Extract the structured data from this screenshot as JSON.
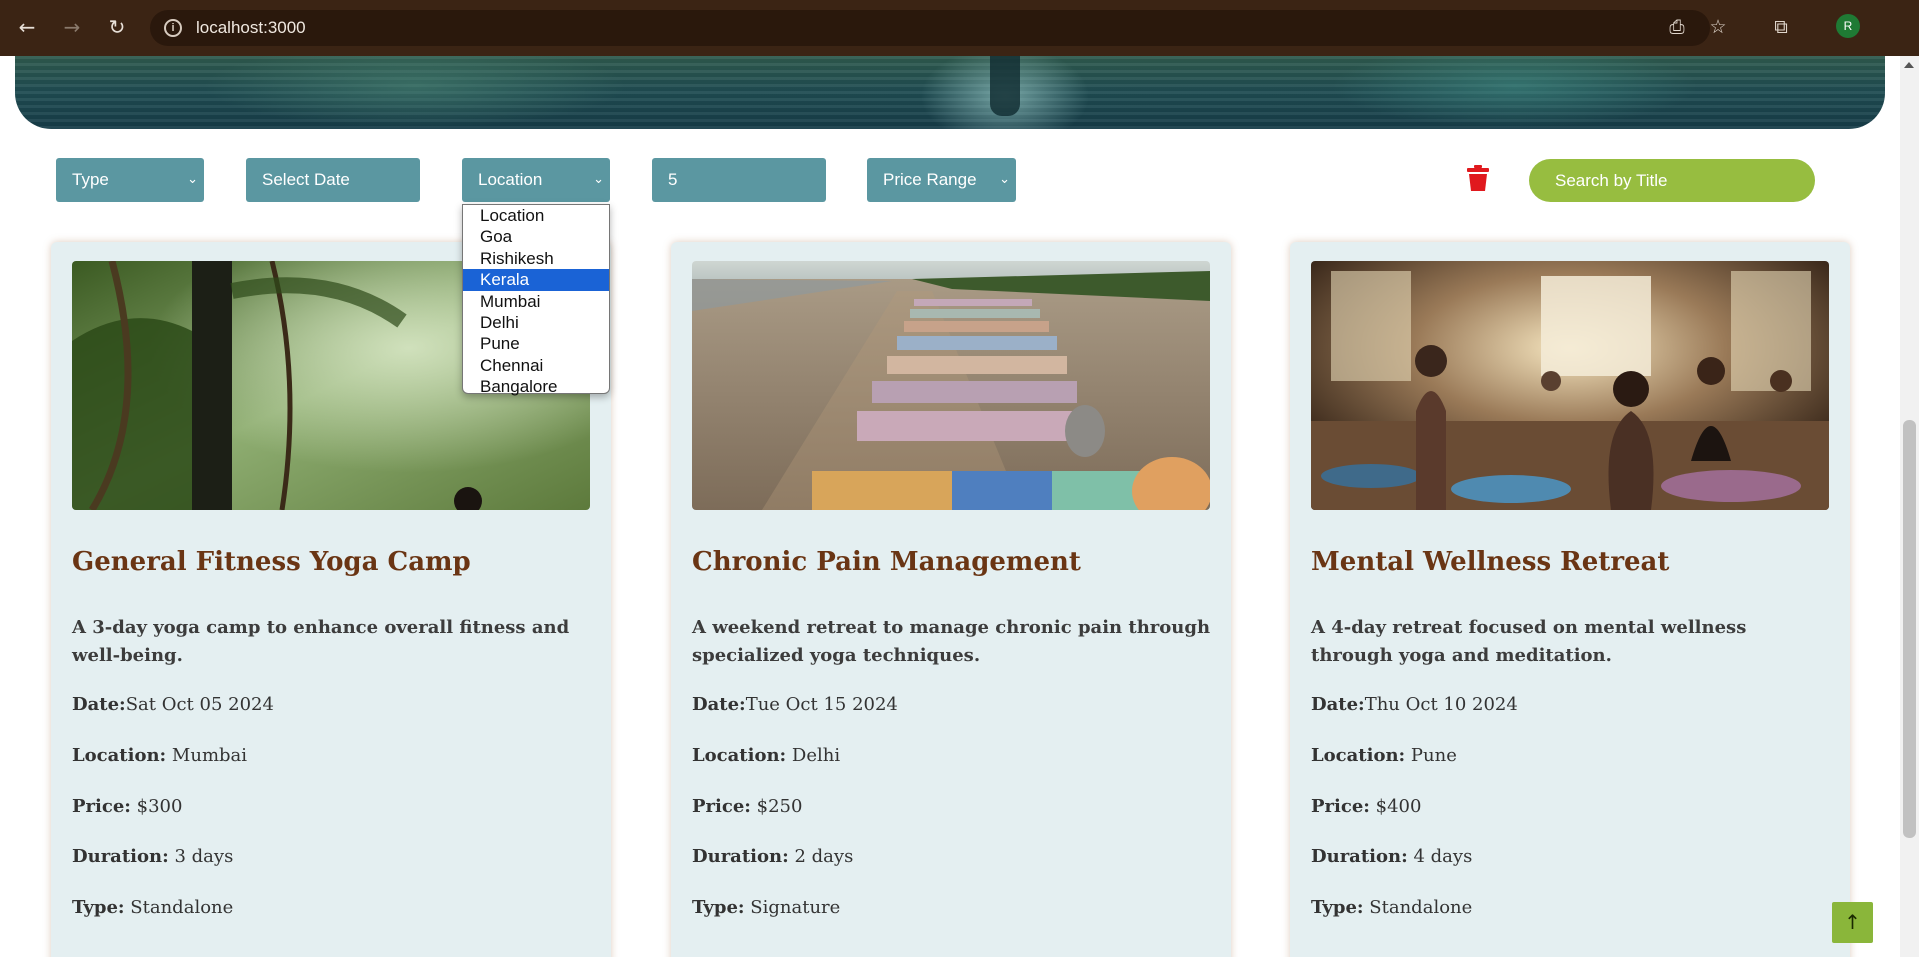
{
  "browser": {
    "url": "localhost:3000",
    "avatar_letter": "R",
    "icons": {
      "back": "arrow-left-icon",
      "forward": "arrow-right-icon",
      "reload": "reload-icon",
      "info": "site-info-icon",
      "install": "install-app-icon",
      "bookmark": "star-icon",
      "extensions": "puzzle-icon"
    }
  },
  "filters": {
    "type": "Type",
    "date": "Select Date",
    "location": "Location",
    "count": "5",
    "price": "Price Range",
    "search_placeholder": "Search by Title",
    "clear_icon": "trash-icon"
  },
  "location_dropdown": {
    "options": [
      "Location",
      "Goa",
      "Rishikesh",
      "Kerala",
      "Mumbai",
      "Delhi",
      "Pune",
      "Chennai",
      "Bangalore"
    ],
    "highlighted": "Kerala"
  },
  "labels": {
    "date": "Date:",
    "location": "Location:",
    "price": "Price:",
    "duration": "Duration:",
    "type": "Type:"
  },
  "cards": [
    {
      "title": "General Fitness Yoga Camp",
      "description": "A 3-day yoga camp to enhance overall fitness and well-being.",
      "date": "Sat Oct 05 2024",
      "location": "Mumbai",
      "price": "$300",
      "duration": "3 days",
      "type": "Standalone"
    },
    {
      "title": "Chronic Pain Management",
      "description": "A weekend retreat to manage chronic pain through specialized yoga techniques.",
      "date": "Tue Oct 15 2024",
      "location": "Delhi",
      "price": "$250",
      "duration": "2 days",
      "type": "Signature"
    },
    {
      "title": "Mental Wellness Retreat",
      "description": "A 4-day retreat focused on mental wellness through yoga and meditation.",
      "date": "Thu Oct 10 2024",
      "location": "Pune",
      "price": "$400",
      "duration": "4 days",
      "type": "Standalone"
    }
  ],
  "scroll_top_label": "↑",
  "colors": {
    "chrome": "#3b2414",
    "filter": "#5b97a1",
    "search": "#97bd40",
    "card_bg": "#e4eff1",
    "title": "#6a3514",
    "trash": "#e0191e",
    "dropdown_highlight": "#1a63d6"
  }
}
